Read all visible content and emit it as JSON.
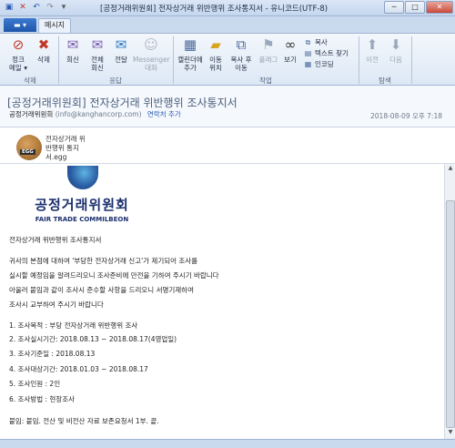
{
  "window": {
    "title": "[공정거래위원회] 전자상거래 위반행위 조사통지서 - 유니코드(UTF-8)",
    "minimize": "─",
    "maximize": "□",
    "close": "✕"
  },
  "tabs": {
    "file": "",
    "message": "메시지"
  },
  "ribbon": {
    "delete_group": {
      "label": "삭제",
      "junk": "정크\n메일 ▾",
      "delete": "삭제"
    },
    "respond_group": {
      "label": "응답",
      "reply": "회신",
      "reply_all": "전체\n회신",
      "forward": "전달",
      "messenger": "Messenger\n대화"
    },
    "actions_group": {
      "label": "작업",
      "add_calendar": "캘린더에\n추가",
      "move": "이동\n위치",
      "copy": "복사 후\n이동",
      "flag": "플래그",
      "view": "보기",
      "copy_small": "복사",
      "find_text": "텍스트 찾기",
      "encoding": "인코딩"
    },
    "nav_group": {
      "label": "탐색",
      "prev": "이전",
      "next": "다음"
    }
  },
  "header": {
    "subject": "[공정거래위원회] 전자상거래 위반행위 조사통지서",
    "sender_name": "공정거래위원회",
    "sender_email": "(info@kanghancorp.com)",
    "add_contact": "연락처 추가",
    "date": "2018-08-09 오후 7:18"
  },
  "attachment": {
    "line1": "전자상거래 위",
    "line2": "반행위 통지",
    "line3": "서.egg",
    "badge": "EGG"
  },
  "logo": {
    "korean": "공정거래위원회",
    "english": "FAIR TRADE COMMILBEON"
  },
  "body": {
    "heading": "전자상거래 위반행위 조사통지서",
    "p1": "귀사의 본점에 대하여 '부당한 전자상거래 신고'가 제기되어 조사를",
    "p2": "실시할 예정임을 알려드리오니 조사준비에 만전을 기하여 주시기 바랍니다",
    "p3": "아울러 붙임과 같이 조사시 준수할 사항을 드리오니 서명기재하여",
    "p4": "조사시 교부하여 주시기 바랍니다",
    "i1": "1. 조사목적   : 부당 전자상거래 위반행위 조사",
    "i2": "2. 조사실시기간: 2018.08.13 ~ 2018.08.17(4영업일)",
    "i3": "3. 조사기준일 : 2018.08.13",
    "i4": "4. 조사대상기간: 2018.01.03 ~ 2018.08.17",
    "i5": "5. 조사인원    : 2인",
    "i6": "6. 조사방법    : 현장조사",
    "attach_note": "붙임: 붙임. 전산 및 비전산 자료 보존요청서 1부. 끝."
  },
  "colors": {
    "ribbon_bg": "#dde8f5",
    "subject": "#4b5f7d",
    "link": "#2a5ab3",
    "logo_blue": "#1b2f6e"
  }
}
